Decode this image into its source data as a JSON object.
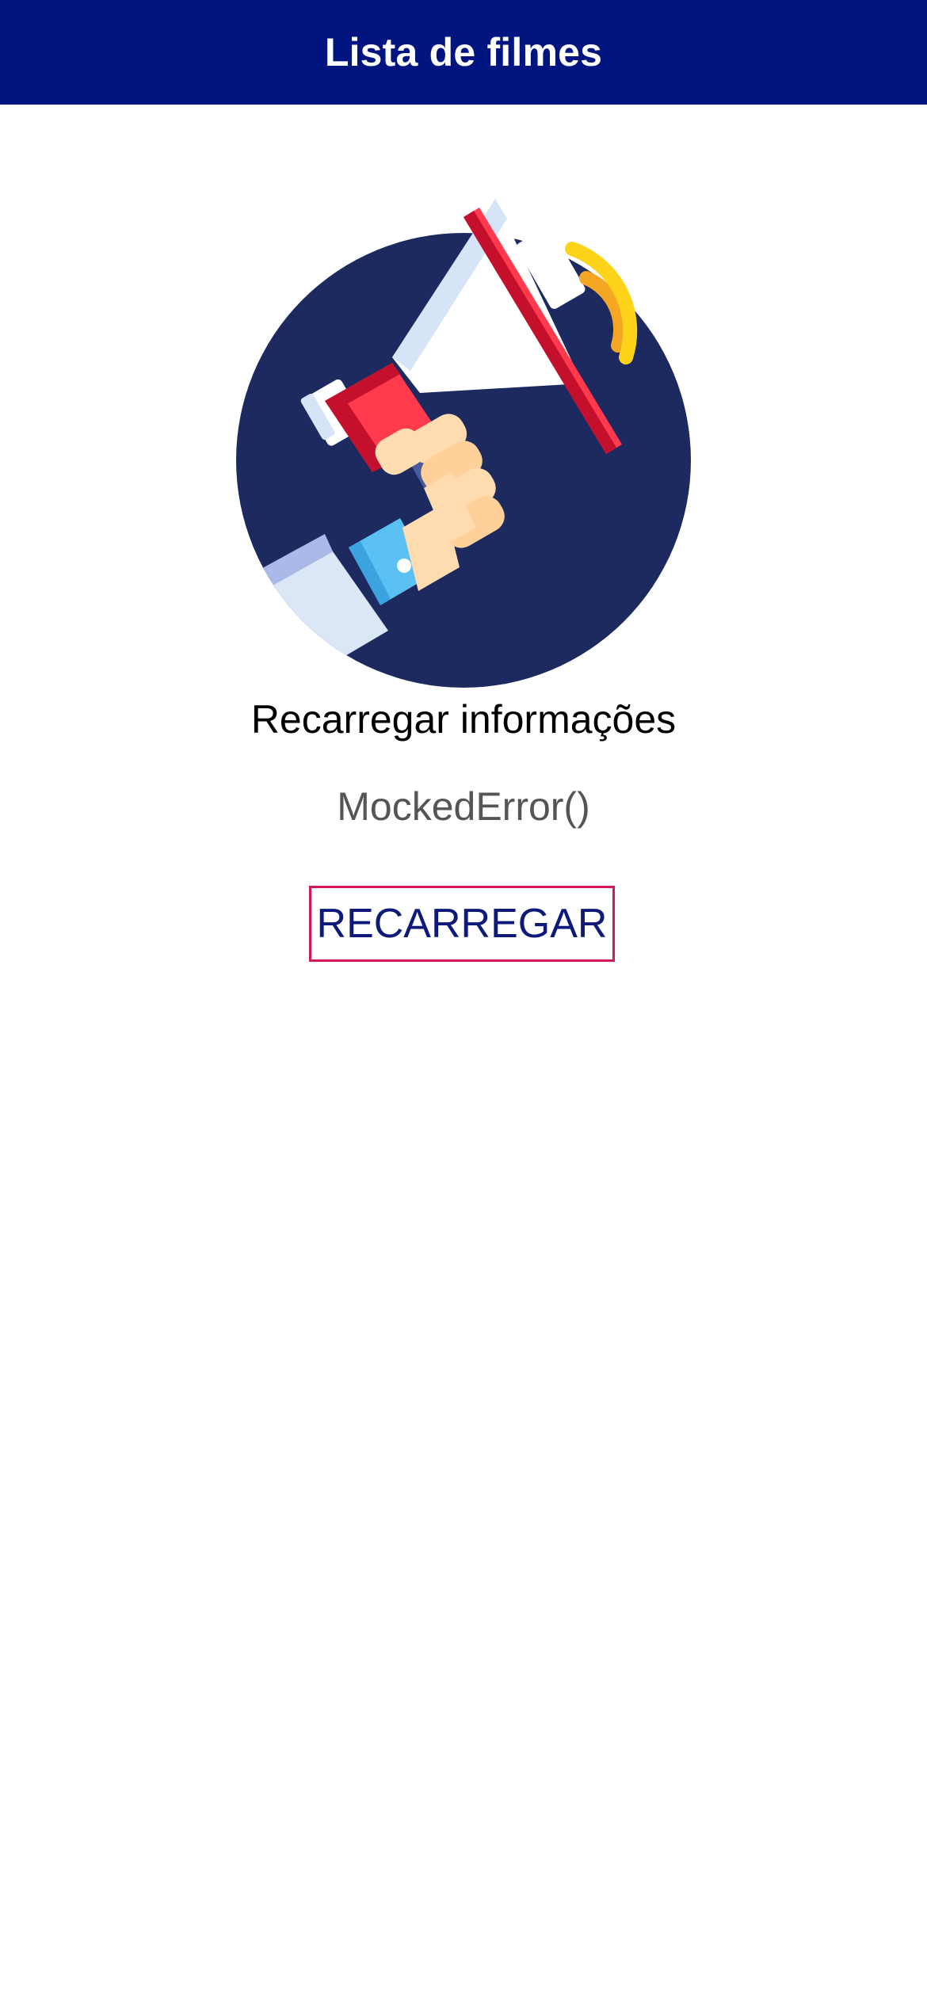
{
  "header": {
    "title": "Lista de filmes"
  },
  "error": {
    "title": "Recarregar informações",
    "message": "MockedError()",
    "illustration_icon": "megaphone-icon"
  },
  "actions": {
    "reload_label": "RECARREGAR"
  },
  "colors": {
    "nav_background": "#001580",
    "circle_background": "#1c2a60",
    "button_border": "#d6175a",
    "button_text": "#0d1a7a"
  }
}
